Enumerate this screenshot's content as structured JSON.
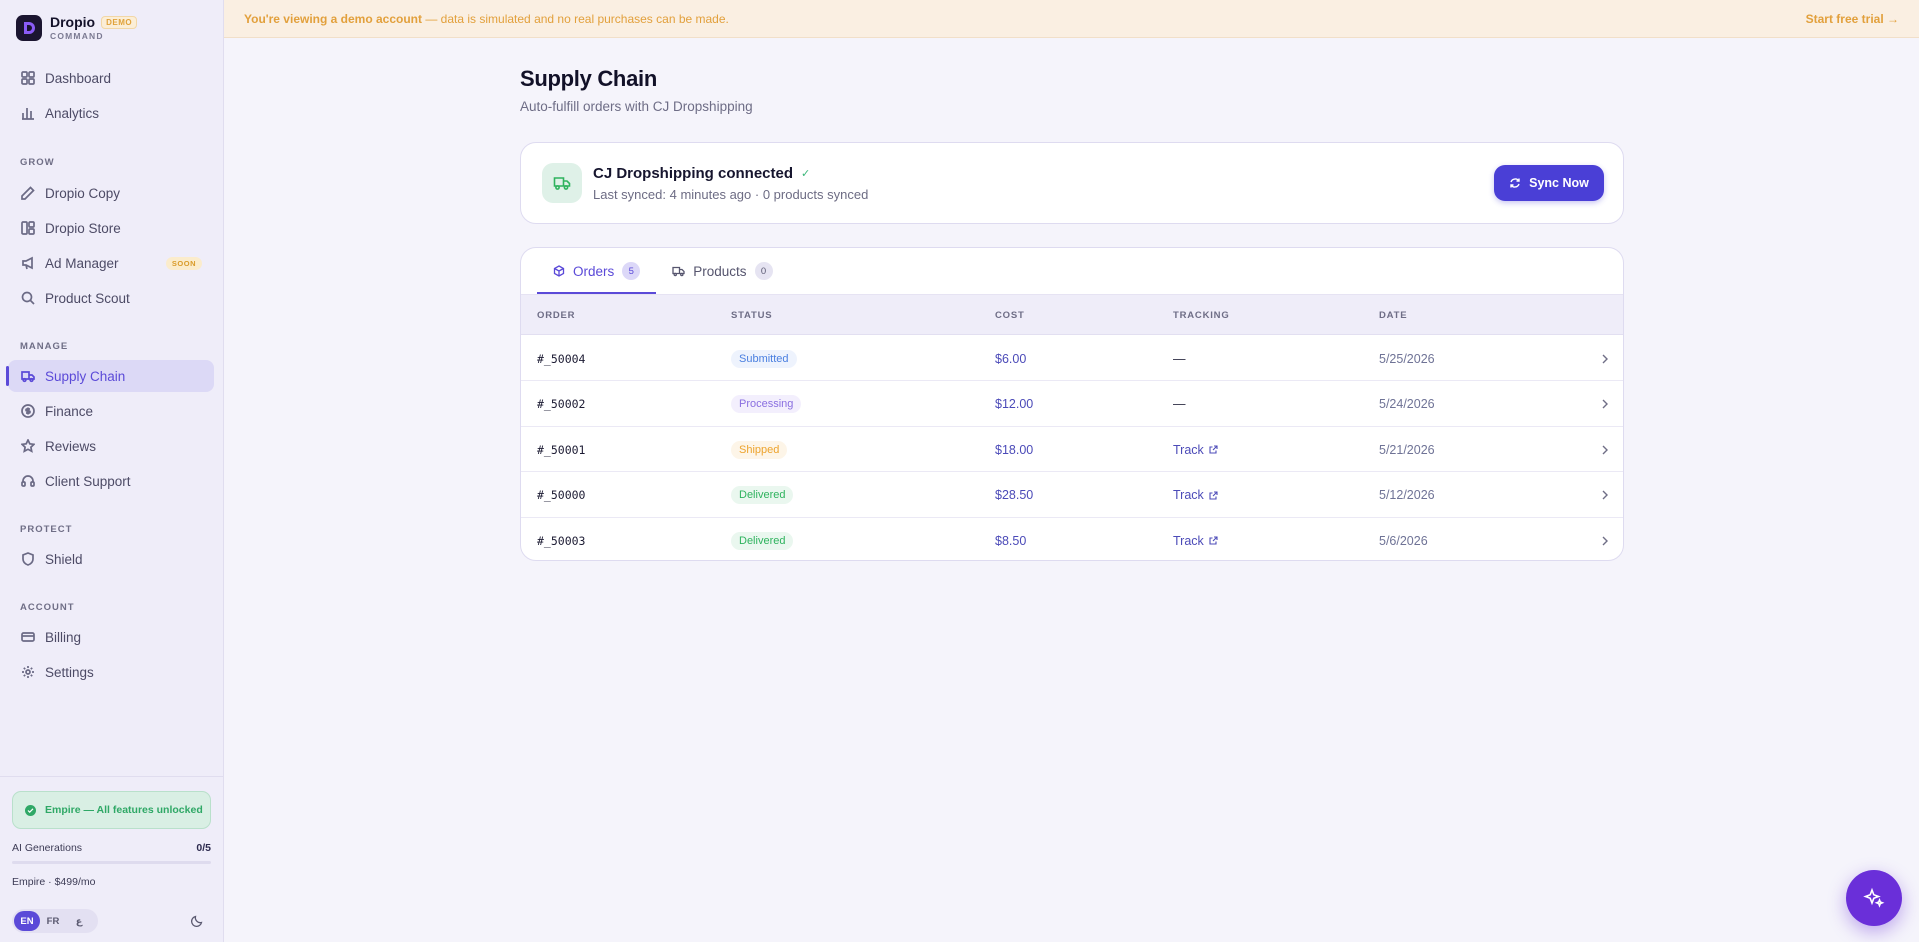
{
  "brand": {
    "name": "Dropio",
    "badge": "DEMO",
    "sub": "COMMAND"
  },
  "sidebar": {
    "top": [
      {
        "label": "Dashboard",
        "icon": "grid-icon"
      },
      {
        "label": "Analytics",
        "icon": "bar-chart-icon"
      }
    ],
    "sections": {
      "grow": "GROW",
      "manage": "MANAGE",
      "protect": "PROTECT",
      "account": "ACCOUNT"
    },
    "grow": [
      {
        "label": "Dropio Copy",
        "icon": "pen-icon"
      },
      {
        "label": "Dropio Store",
        "icon": "store-icon"
      },
      {
        "label": "Ad Manager",
        "icon": "megaphone-icon",
        "badge": "SOON"
      },
      {
        "label": "Product Scout",
        "icon": "search-icon"
      }
    ],
    "manage": [
      {
        "label": "Supply Chain",
        "icon": "truck-icon",
        "active": true
      },
      {
        "label": "Finance",
        "icon": "dollar-icon"
      },
      {
        "label": "Reviews",
        "icon": "star-icon"
      },
      {
        "label": "Client Support",
        "icon": "headset-icon"
      }
    ],
    "protect": [
      {
        "label": "Shield",
        "icon": "shield-icon"
      }
    ],
    "account": [
      {
        "label": "Billing",
        "icon": "card-icon"
      },
      {
        "label": "Settings",
        "icon": "gear-icon"
      }
    ],
    "footer": {
      "plan_status": "Empire — All features unlocked",
      "ai_label": "AI Generations",
      "ai_count": "0/5",
      "ai_progress": 0,
      "plan_price": "Empire · $499/mo",
      "langs": [
        "EN",
        "FR",
        "ع"
      ],
      "active_lang": "EN"
    }
  },
  "banner": {
    "text_bold": "You're viewing a demo account",
    "text_rest": " — data is simulated and no real purchases can be made.",
    "cta": "Start free trial →"
  },
  "page": {
    "title": "Supply Chain",
    "subtitle": "Auto-fulfill orders with CJ Dropshipping"
  },
  "connection": {
    "title": "CJ Dropshipping connected",
    "meta": "Last synced: 4 minutes ago · 0 products synced",
    "sync_label": "Sync Now"
  },
  "tabs": [
    {
      "label": "Orders",
      "count": "5",
      "active": true
    },
    {
      "label": "Products",
      "count": "0",
      "active": false
    }
  ],
  "table": {
    "headers": {
      "order": "ORDER",
      "status": "STATUS",
      "cost": "COST",
      "tracking": "TRACKING",
      "date": "DATE"
    },
    "rows": [
      {
        "order": "#_50004",
        "status": "Submitted",
        "cost": "$6.00",
        "tracking": "—",
        "date": "5/25/2026"
      },
      {
        "order": "#_50002",
        "status": "Processing",
        "cost": "$12.00",
        "tracking": "—",
        "date": "5/24/2026"
      },
      {
        "order": "#_50001",
        "status": "Shipped",
        "cost": "$18.00",
        "tracking": "Track",
        "date": "5/21/2026"
      },
      {
        "order": "#_50000",
        "status": "Delivered",
        "cost": "$28.50",
        "tracking": "Track",
        "date": "5/12/2026"
      },
      {
        "order": "#_50003",
        "status": "Delivered",
        "cost": "$8.50",
        "tracking": "Track",
        "date": "5/6/2026"
      }
    ]
  },
  "colors": {
    "accent": "#5b4ad8",
    "submitted": "#4a7fe0",
    "processing": "#8a6fe0",
    "shipped": "#eda32c",
    "delivered": "#2fb35e",
    "banner_text": "#e2a03c"
  }
}
